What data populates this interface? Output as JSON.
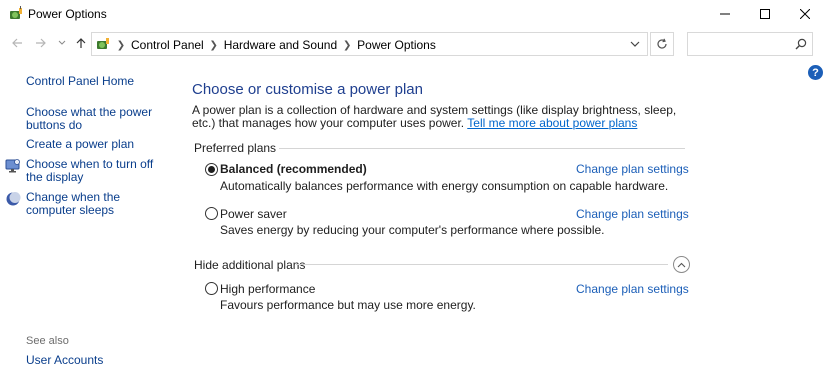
{
  "window": {
    "title": "Power Options",
    "icon": "power-options-icon"
  },
  "nav": {
    "breadcrumbs": [
      "Control Panel",
      "Hardware and Sound",
      "Power Options"
    ],
    "search_placeholder": ""
  },
  "left_pane": {
    "home": "Control Panel Home",
    "tasks": [
      {
        "label": "Choose what the power buttons do",
        "icon": null
      },
      {
        "label": "Create a power plan",
        "icon": null
      },
      {
        "label": "Choose when to turn off the display",
        "icon": "display-icon"
      },
      {
        "label": "Change when the computer sleeps",
        "icon": "moon-icon"
      }
    ],
    "see_also_heading": "See also",
    "see_also": [
      "User Accounts"
    ]
  },
  "main": {
    "title": "Choose or customise a power plan",
    "description": "A power plan is a collection of hardware and system settings (like display brightness, sleep, etc.) that manages how your computer uses power.",
    "learn_more_link": "Tell me more about power plans",
    "preferred_heading": "Preferred plans",
    "hidden_heading": "Hide additional plans",
    "change_link": "Change plan settings",
    "plans": [
      {
        "name": "Balanced (recommended)",
        "description": "Automatically balances performance with energy consumption on capable hardware.",
        "selected": true
      },
      {
        "name": "Power saver",
        "description": "Saves energy by reducing your computer's performance where possible.",
        "selected": false
      },
      {
        "name": "High performance",
        "description": "Favours performance but may use more energy.",
        "selected": false
      }
    ]
  },
  "colors": {
    "link": "#1c5fb8",
    "title": "#1f3f8f",
    "left_link": "#0a3e8c"
  }
}
